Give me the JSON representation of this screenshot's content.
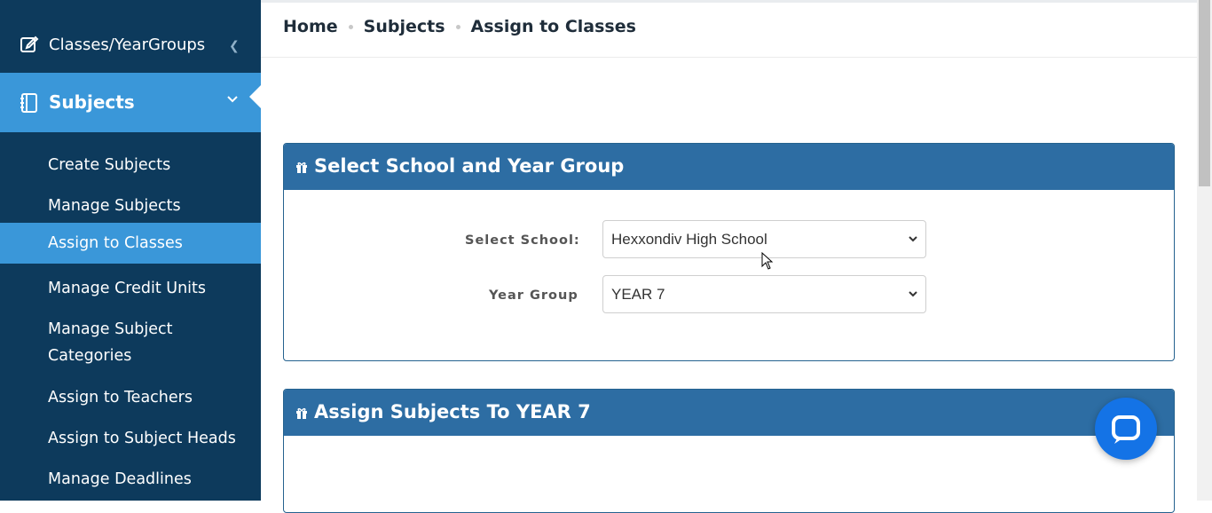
{
  "sidebar": {
    "top_item": {
      "label": "Classes/YearGroups",
      "icon": "edit-icon"
    },
    "active_item": {
      "label": "Subjects",
      "icon": "notebook-icon"
    },
    "submenu": [
      "Create Subjects",
      "Manage Subjects",
      "Assign to Classes",
      "Manage Credit Units",
      "Manage Subject Categories",
      "Assign to Teachers",
      "Assign to Subject Heads",
      "Manage Deadlines"
    ],
    "submenu_two_line": {
      "line1": "Manage Subject",
      "line2": "Categories"
    }
  },
  "breadcrumb": {
    "home": "Home",
    "subjects": "Subjects",
    "current": "Assign to Classes"
  },
  "card1": {
    "title": "Select School and Year Group",
    "school_label": "Select School:",
    "school_value": "Hexxondiv High School",
    "year_label": "Year Group",
    "year_value": "YEAR 7"
  },
  "card2": {
    "title": "Assign Subjects To YEAR 7"
  },
  "colors": {
    "sidebar_bg": "#0d3a5c",
    "accent": "#3a97d9",
    "card_header": "#2d6da3",
    "chat_button": "#1473e6"
  }
}
